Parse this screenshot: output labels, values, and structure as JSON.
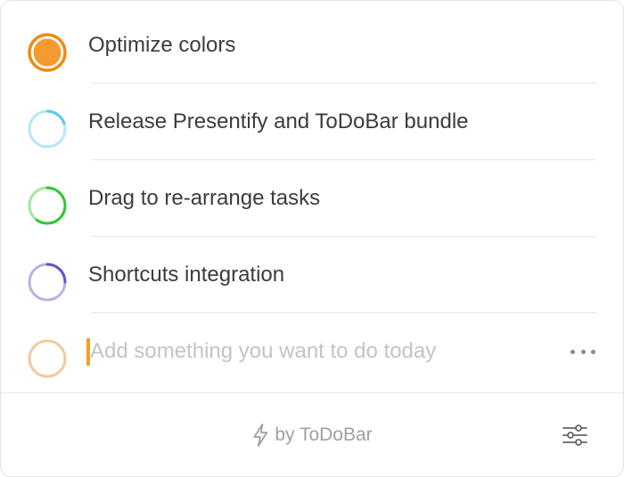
{
  "tasks": [
    {
      "label": "Optimize colors",
      "color": "#f08a12",
      "progress": 1.0,
      "icon": "filled-circle-icon"
    },
    {
      "label": "Release Presentify and ToDoBar bundle",
      "color": "#5cc8f0",
      "progress": 0.2,
      "icon": "progress-ring-icon"
    },
    {
      "label": "Drag to re-arrange tasks",
      "color": "#2fc82f",
      "progress": 0.6,
      "icon": "progress-ring-icon"
    },
    {
      "label": "Shortcuts integration",
      "color": "#5a55cc",
      "progress": 0.25,
      "icon": "progress-ring-icon"
    }
  ],
  "new_task": {
    "placeholder": "Add something you want to do today",
    "ring_color": "#f5c89a",
    "caret_color": "#f0a12a",
    "more_icon": "ellipsis-icon"
  },
  "footer": {
    "brand_text": "by ToDoBar",
    "brand_icon": "bolt-icon",
    "settings_icon": "sliders-icon",
    "muted_color": "#a0a0a0"
  }
}
